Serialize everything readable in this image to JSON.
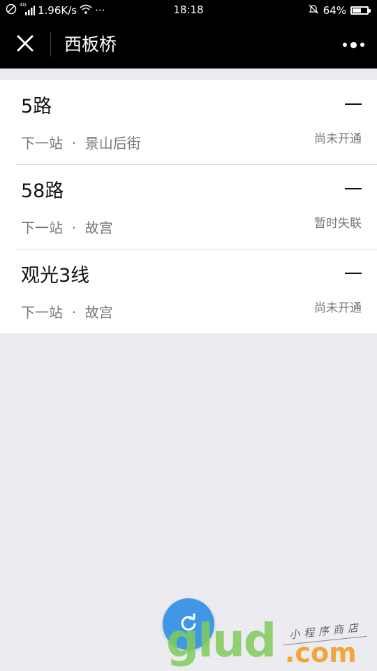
{
  "status_bar": {
    "network": "4G",
    "speed": "1.96K/s",
    "more": "···",
    "time": "18:18",
    "battery": "64%",
    "battery_level": 0.64
  },
  "nav": {
    "title": "西板桥"
  },
  "routes": [
    {
      "name": "5路",
      "next_label": "下一站",
      "separator": "·",
      "next_stop": "景山后街",
      "status": "尚未开通"
    },
    {
      "name": "58路",
      "next_label": "下一站",
      "separator": "·",
      "next_stop": "故宫",
      "status": "暂时失联"
    },
    {
      "name": "观光3线",
      "next_label": "下一站",
      "separator": "·",
      "next_stop": "故宫",
      "status": "尚未开通"
    }
  ],
  "watermark": {
    "brand": "glud",
    "domain": ".com",
    "tagline": "小程序商店"
  },
  "icons": {
    "close": "close-icon",
    "more": "more-dots-icon",
    "refresh": "refresh-icon"
  },
  "colors": {
    "nav_bg": "#000000",
    "page_bg": "#ebebf0",
    "refresh_button": "#3f97e6"
  }
}
